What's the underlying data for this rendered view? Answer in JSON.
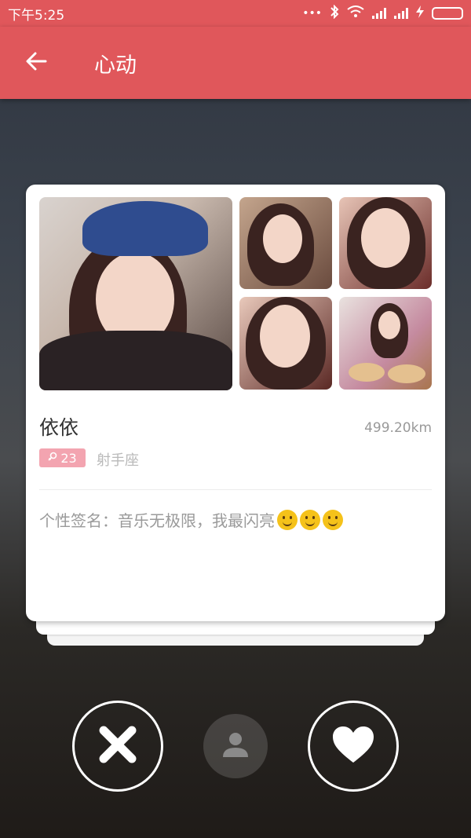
{
  "status_bar": {
    "time": "下午5:25",
    "dots": "•••"
  },
  "app_bar": {
    "title": "心动"
  },
  "profile": {
    "name": "依依",
    "distance": "499.20km",
    "age": "23",
    "zodiac": "射手座",
    "signature_label": "个性签名：",
    "signature_text": "音乐无极限，我最闪亮"
  },
  "colors": {
    "accent": "#e0575b",
    "badge": "#f3a4b0",
    "battery": "#6fd33a"
  },
  "icons": {
    "back": "back-arrow-icon",
    "dislike": "close-icon",
    "profile": "person-icon",
    "like": "heart-icon"
  }
}
